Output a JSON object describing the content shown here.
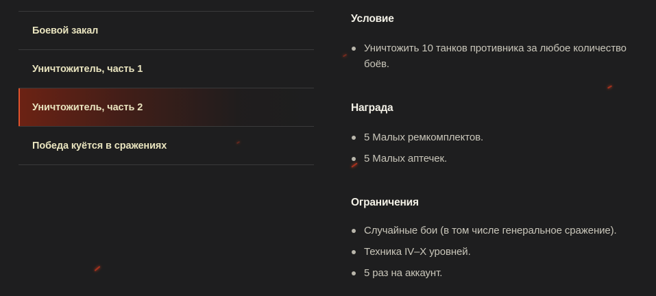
{
  "menu": {
    "items": [
      {
        "label": "Боевой закал",
        "active": false
      },
      {
        "label": "Уничтожитель, часть 1",
        "active": false
      },
      {
        "label": "Уничтожитель, часть 2",
        "active": true
      },
      {
        "label": "Победа куётся в сражениях",
        "active": false
      }
    ]
  },
  "sections": {
    "condition": {
      "title": "Условие",
      "items": [
        "Уничтожить 10 танков противника за любое количество боёв."
      ]
    },
    "reward": {
      "title": "Награда",
      "items": [
        "5 Малых ремкомплектов.",
        "5 Малых аптечек."
      ]
    },
    "restrictions": {
      "title": "Ограничения",
      "items": [
        "Случайные бои (в том числе генеральное сражение).",
        "Техника IV–X уровней.",
        "5 раз на аккаунт."
      ]
    }
  },
  "colors": {
    "background": "#1e1e1f",
    "accent": "#e0532c",
    "menu_text": "#e9e4bf",
    "body_text": "#c9c6ba"
  }
}
